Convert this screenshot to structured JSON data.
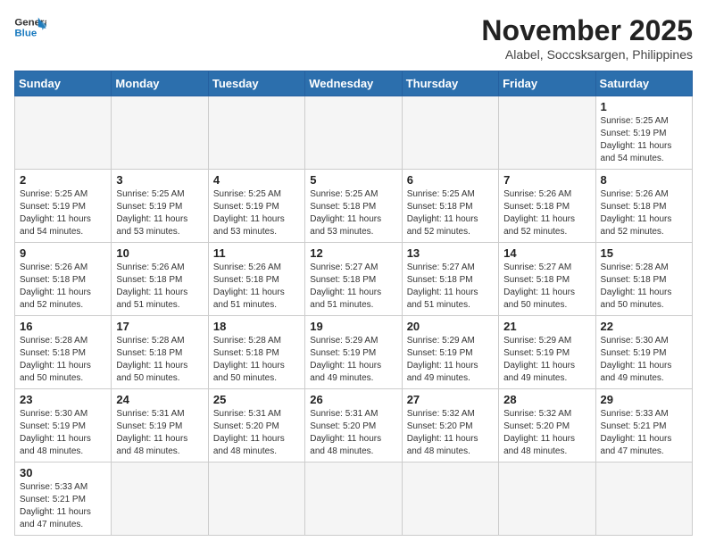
{
  "logo": {
    "line1": "General",
    "line2": "Blue"
  },
  "title": "November 2025",
  "subtitle": "Alabel, Soccsksargen, Philippines",
  "weekdays": [
    "Sunday",
    "Monday",
    "Tuesday",
    "Wednesday",
    "Thursday",
    "Friday",
    "Saturday"
  ],
  "weeks": [
    [
      {
        "day": "",
        "info": ""
      },
      {
        "day": "",
        "info": ""
      },
      {
        "day": "",
        "info": ""
      },
      {
        "day": "",
        "info": ""
      },
      {
        "day": "",
        "info": ""
      },
      {
        "day": "",
        "info": ""
      },
      {
        "day": "1",
        "info": "Sunrise: 5:25 AM\nSunset: 5:19 PM\nDaylight: 11 hours\nand 54 minutes."
      }
    ],
    [
      {
        "day": "2",
        "info": "Sunrise: 5:25 AM\nSunset: 5:19 PM\nDaylight: 11 hours\nand 54 minutes."
      },
      {
        "day": "3",
        "info": "Sunrise: 5:25 AM\nSunset: 5:19 PM\nDaylight: 11 hours\nand 53 minutes."
      },
      {
        "day": "4",
        "info": "Sunrise: 5:25 AM\nSunset: 5:19 PM\nDaylight: 11 hours\nand 53 minutes."
      },
      {
        "day": "5",
        "info": "Sunrise: 5:25 AM\nSunset: 5:18 PM\nDaylight: 11 hours\nand 53 minutes."
      },
      {
        "day": "6",
        "info": "Sunrise: 5:25 AM\nSunset: 5:18 PM\nDaylight: 11 hours\nand 52 minutes."
      },
      {
        "day": "7",
        "info": "Sunrise: 5:26 AM\nSunset: 5:18 PM\nDaylight: 11 hours\nand 52 minutes."
      },
      {
        "day": "8",
        "info": "Sunrise: 5:26 AM\nSunset: 5:18 PM\nDaylight: 11 hours\nand 52 minutes."
      }
    ],
    [
      {
        "day": "9",
        "info": "Sunrise: 5:26 AM\nSunset: 5:18 PM\nDaylight: 11 hours\nand 52 minutes."
      },
      {
        "day": "10",
        "info": "Sunrise: 5:26 AM\nSunset: 5:18 PM\nDaylight: 11 hours\nand 51 minutes."
      },
      {
        "day": "11",
        "info": "Sunrise: 5:26 AM\nSunset: 5:18 PM\nDaylight: 11 hours\nand 51 minutes."
      },
      {
        "day": "12",
        "info": "Sunrise: 5:27 AM\nSunset: 5:18 PM\nDaylight: 11 hours\nand 51 minutes."
      },
      {
        "day": "13",
        "info": "Sunrise: 5:27 AM\nSunset: 5:18 PM\nDaylight: 11 hours\nand 51 minutes."
      },
      {
        "day": "14",
        "info": "Sunrise: 5:27 AM\nSunset: 5:18 PM\nDaylight: 11 hours\nand 50 minutes."
      },
      {
        "day": "15",
        "info": "Sunrise: 5:28 AM\nSunset: 5:18 PM\nDaylight: 11 hours\nand 50 minutes."
      }
    ],
    [
      {
        "day": "16",
        "info": "Sunrise: 5:28 AM\nSunset: 5:18 PM\nDaylight: 11 hours\nand 50 minutes."
      },
      {
        "day": "17",
        "info": "Sunrise: 5:28 AM\nSunset: 5:18 PM\nDaylight: 11 hours\nand 50 minutes."
      },
      {
        "day": "18",
        "info": "Sunrise: 5:28 AM\nSunset: 5:18 PM\nDaylight: 11 hours\nand 50 minutes."
      },
      {
        "day": "19",
        "info": "Sunrise: 5:29 AM\nSunset: 5:19 PM\nDaylight: 11 hours\nand 49 minutes."
      },
      {
        "day": "20",
        "info": "Sunrise: 5:29 AM\nSunset: 5:19 PM\nDaylight: 11 hours\nand 49 minutes."
      },
      {
        "day": "21",
        "info": "Sunrise: 5:29 AM\nSunset: 5:19 PM\nDaylight: 11 hours\nand 49 minutes."
      },
      {
        "day": "22",
        "info": "Sunrise: 5:30 AM\nSunset: 5:19 PM\nDaylight: 11 hours\nand 49 minutes."
      }
    ],
    [
      {
        "day": "23",
        "info": "Sunrise: 5:30 AM\nSunset: 5:19 PM\nDaylight: 11 hours\nand 48 minutes."
      },
      {
        "day": "24",
        "info": "Sunrise: 5:31 AM\nSunset: 5:19 PM\nDaylight: 11 hours\nand 48 minutes."
      },
      {
        "day": "25",
        "info": "Sunrise: 5:31 AM\nSunset: 5:20 PM\nDaylight: 11 hours\nand 48 minutes."
      },
      {
        "day": "26",
        "info": "Sunrise: 5:31 AM\nSunset: 5:20 PM\nDaylight: 11 hours\nand 48 minutes."
      },
      {
        "day": "27",
        "info": "Sunrise: 5:32 AM\nSunset: 5:20 PM\nDaylight: 11 hours\nand 48 minutes."
      },
      {
        "day": "28",
        "info": "Sunrise: 5:32 AM\nSunset: 5:20 PM\nDaylight: 11 hours\nand 48 minutes."
      },
      {
        "day": "29",
        "info": "Sunrise: 5:33 AM\nSunset: 5:21 PM\nDaylight: 11 hours\nand 47 minutes."
      }
    ],
    [
      {
        "day": "30",
        "info": "Sunrise: 5:33 AM\nSunset: 5:21 PM\nDaylight: 11 hours\nand 47 minutes."
      },
      {
        "day": "",
        "info": ""
      },
      {
        "day": "",
        "info": ""
      },
      {
        "day": "",
        "info": ""
      },
      {
        "day": "",
        "info": ""
      },
      {
        "day": "",
        "info": ""
      },
      {
        "day": "",
        "info": ""
      }
    ]
  ]
}
